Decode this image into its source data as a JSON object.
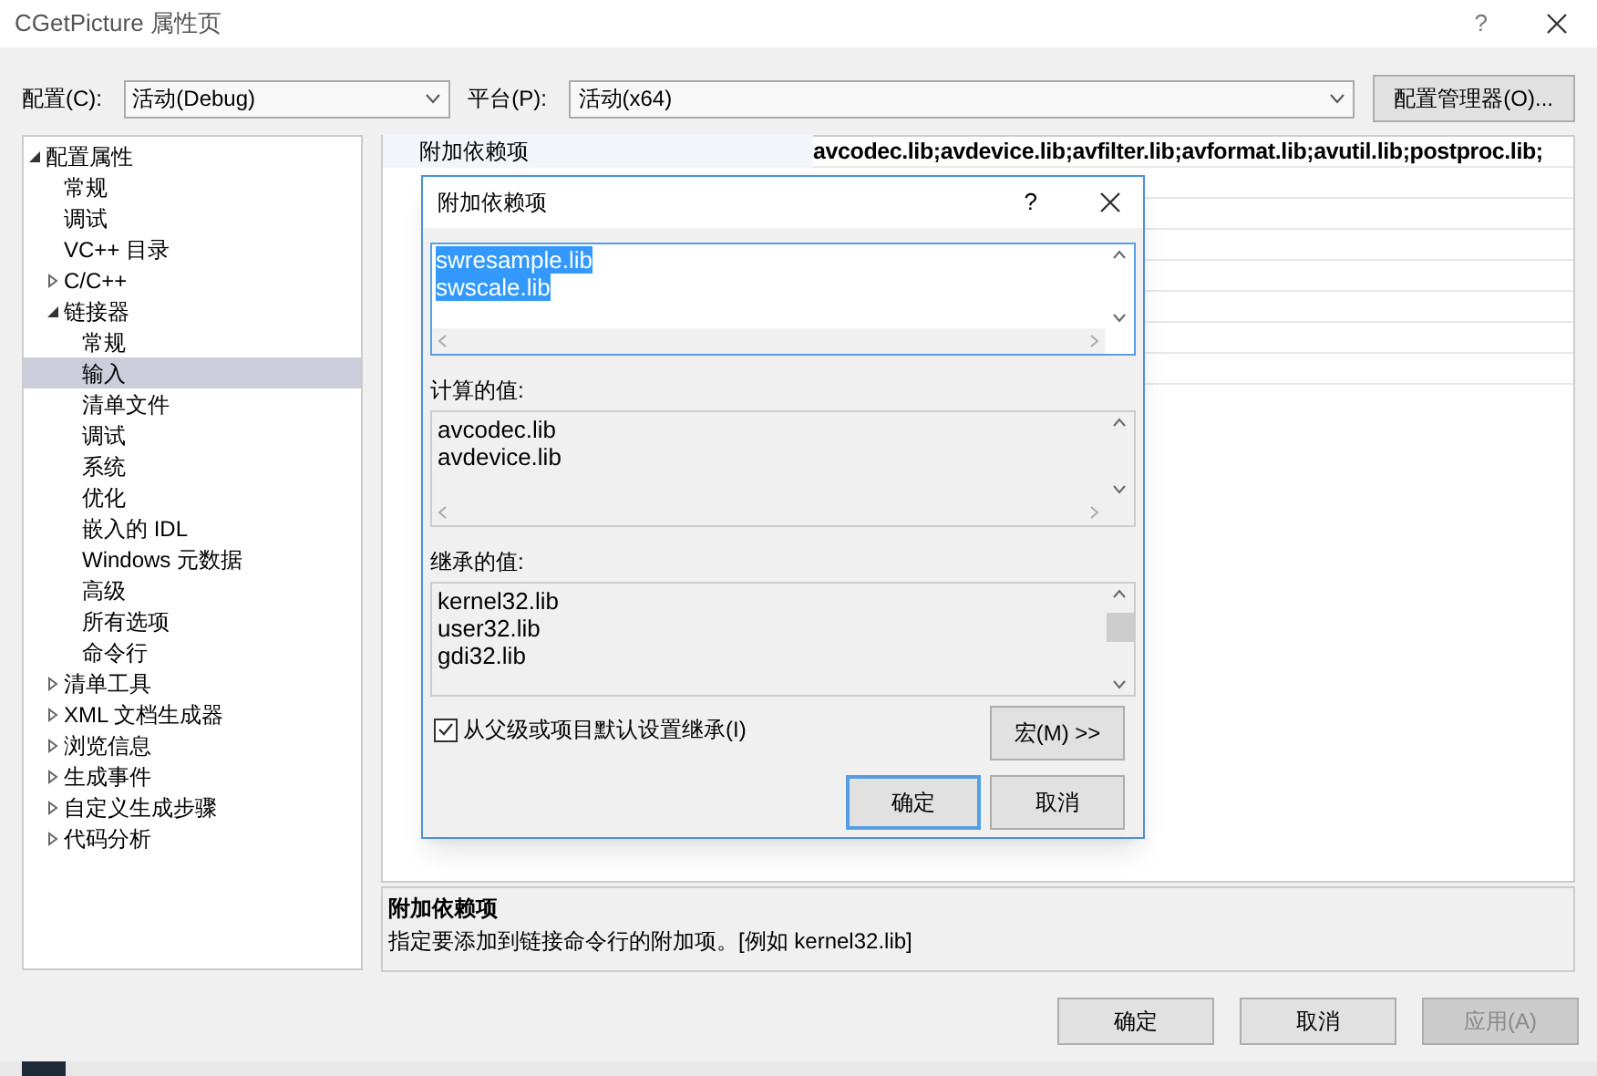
{
  "window": {
    "title": "CGetPicture 属性页",
    "help": "?"
  },
  "config": {
    "label": "配置(C):",
    "value": "活动(Debug)"
  },
  "platform": {
    "label": "平台(P):",
    "value": "活动(x64)"
  },
  "config_manager_button": "配置管理器(O)...",
  "tree": [
    {
      "label": "配置属性",
      "expanded": true,
      "selected": false,
      "children": [
        {
          "label": "常规",
          "selected": false
        },
        {
          "label": "调试",
          "selected": false
        },
        {
          "label": "VC++ 目录",
          "selected": false
        },
        {
          "label": "C/C++",
          "expanded": false,
          "selected": false
        },
        {
          "label": "链接器",
          "expanded": true,
          "selected": false,
          "children": [
            {
              "label": "常规",
              "selected": false
            },
            {
              "label": "输入",
              "selected": true
            },
            {
              "label": "清单文件",
              "selected": false
            },
            {
              "label": "调试",
              "selected": false
            },
            {
              "label": "系统",
              "selected": false
            },
            {
              "label": "优化",
              "selected": false
            },
            {
              "label": "嵌入的 IDL",
              "selected": false
            },
            {
              "label": "Windows 元数据",
              "selected": false
            },
            {
              "label": "高级",
              "selected": false
            },
            {
              "label": "所有选项",
              "selected": false
            },
            {
              "label": "命令行",
              "selected": false
            }
          ]
        },
        {
          "label": "清单工具",
          "expanded": false,
          "selected": false
        },
        {
          "label": "XML 文档生成器",
          "expanded": false,
          "selected": false
        },
        {
          "label": "浏览信息",
          "expanded": false,
          "selected": false
        },
        {
          "label": "生成事件",
          "expanded": false,
          "selected": false
        },
        {
          "label": "自定义生成步骤",
          "expanded": false,
          "selected": false
        },
        {
          "label": "代码分析",
          "expanded": false,
          "selected": false
        }
      ]
    }
  ],
  "property_grid": {
    "rows": [
      {
        "name": "附加依赖项",
        "value": "avcodec.lib;avdevice.lib;avfilter.lib;avformat.lib;avutil.lib;postproc.lib;"
      }
    ]
  },
  "description": {
    "title": "附加依赖项",
    "text": "指定要添加到链接命令行的附加项。[例如 kernel32.lib]"
  },
  "dialog": {
    "title": "附加依赖项",
    "help": "?",
    "edit_lines": [
      {
        "text": "swresample.lib",
        "selected": true
      },
      {
        "text": "swscale.lib",
        "selected": true
      }
    ],
    "computed_label": "计算的值:",
    "computed": [
      "avcodec.lib",
      "avdevice.lib"
    ],
    "inherited_label": "继承的值:",
    "inherited": [
      "kernel32.lib",
      "user32.lib",
      "gdi32.lib"
    ],
    "inherit_checkbox": {
      "label": "从父级或项目默认设置继承(I)",
      "checked": true
    },
    "macro_button": "宏(M) >>",
    "ok": "确定",
    "cancel": "取消"
  },
  "buttons": [
    {
      "label": "确定",
      "disabled": false
    },
    {
      "label": "取消",
      "disabled": false
    },
    {
      "label": "应用(A)",
      "disabled": true
    }
  ]
}
